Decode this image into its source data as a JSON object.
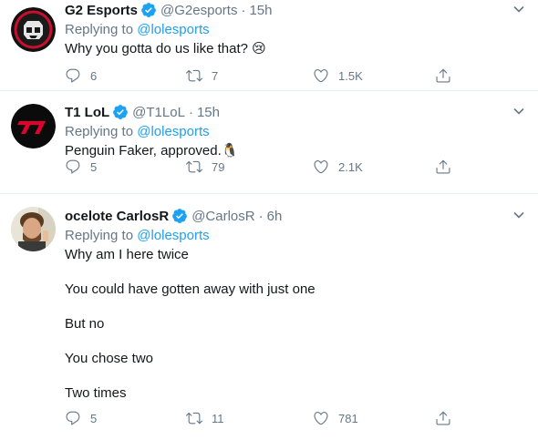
{
  "tweets": [
    {
      "name": "G2 Esports",
      "handle": "@G2esports",
      "time": "15h",
      "replying_prefix": "Replying to",
      "replying_to": "@lolesports",
      "paragraphs": [
        "Why you gotta do us like that? 😢"
      ],
      "replies": "6",
      "retweets": "7",
      "likes": "1.5K",
      "avatar_icon": "g2-logo-icon"
    },
    {
      "name": "T1 LoL",
      "handle": "@T1LoL",
      "time": "15h",
      "replying_prefix": "Replying to",
      "replying_to": "@lolesports",
      "paragraphs": [
        "Penguin Faker, approved.🐧"
      ],
      "replies": "5",
      "retweets": "79",
      "likes": "2.1K",
      "avatar_icon": "t1-logo-icon"
    },
    {
      "name": "ocelote CarlosR",
      "handle": "@CarlosR",
      "time": "6h",
      "replying_prefix": "Replying to",
      "replying_to": "@lolesports",
      "paragraphs": [
        "Why am I here twice",
        "You could have gotten away with just one",
        "But no",
        "You chose two",
        "Two times"
      ],
      "replies": "5",
      "retweets": "11",
      "likes": "781",
      "avatar_icon": "user-photo-avatar"
    }
  ],
  "separator": "·",
  "colors": {
    "link": "#1da1f2",
    "muted": "#657786",
    "text": "#14171a",
    "verified": "#1da1f2",
    "border": "#e6ecf0"
  }
}
